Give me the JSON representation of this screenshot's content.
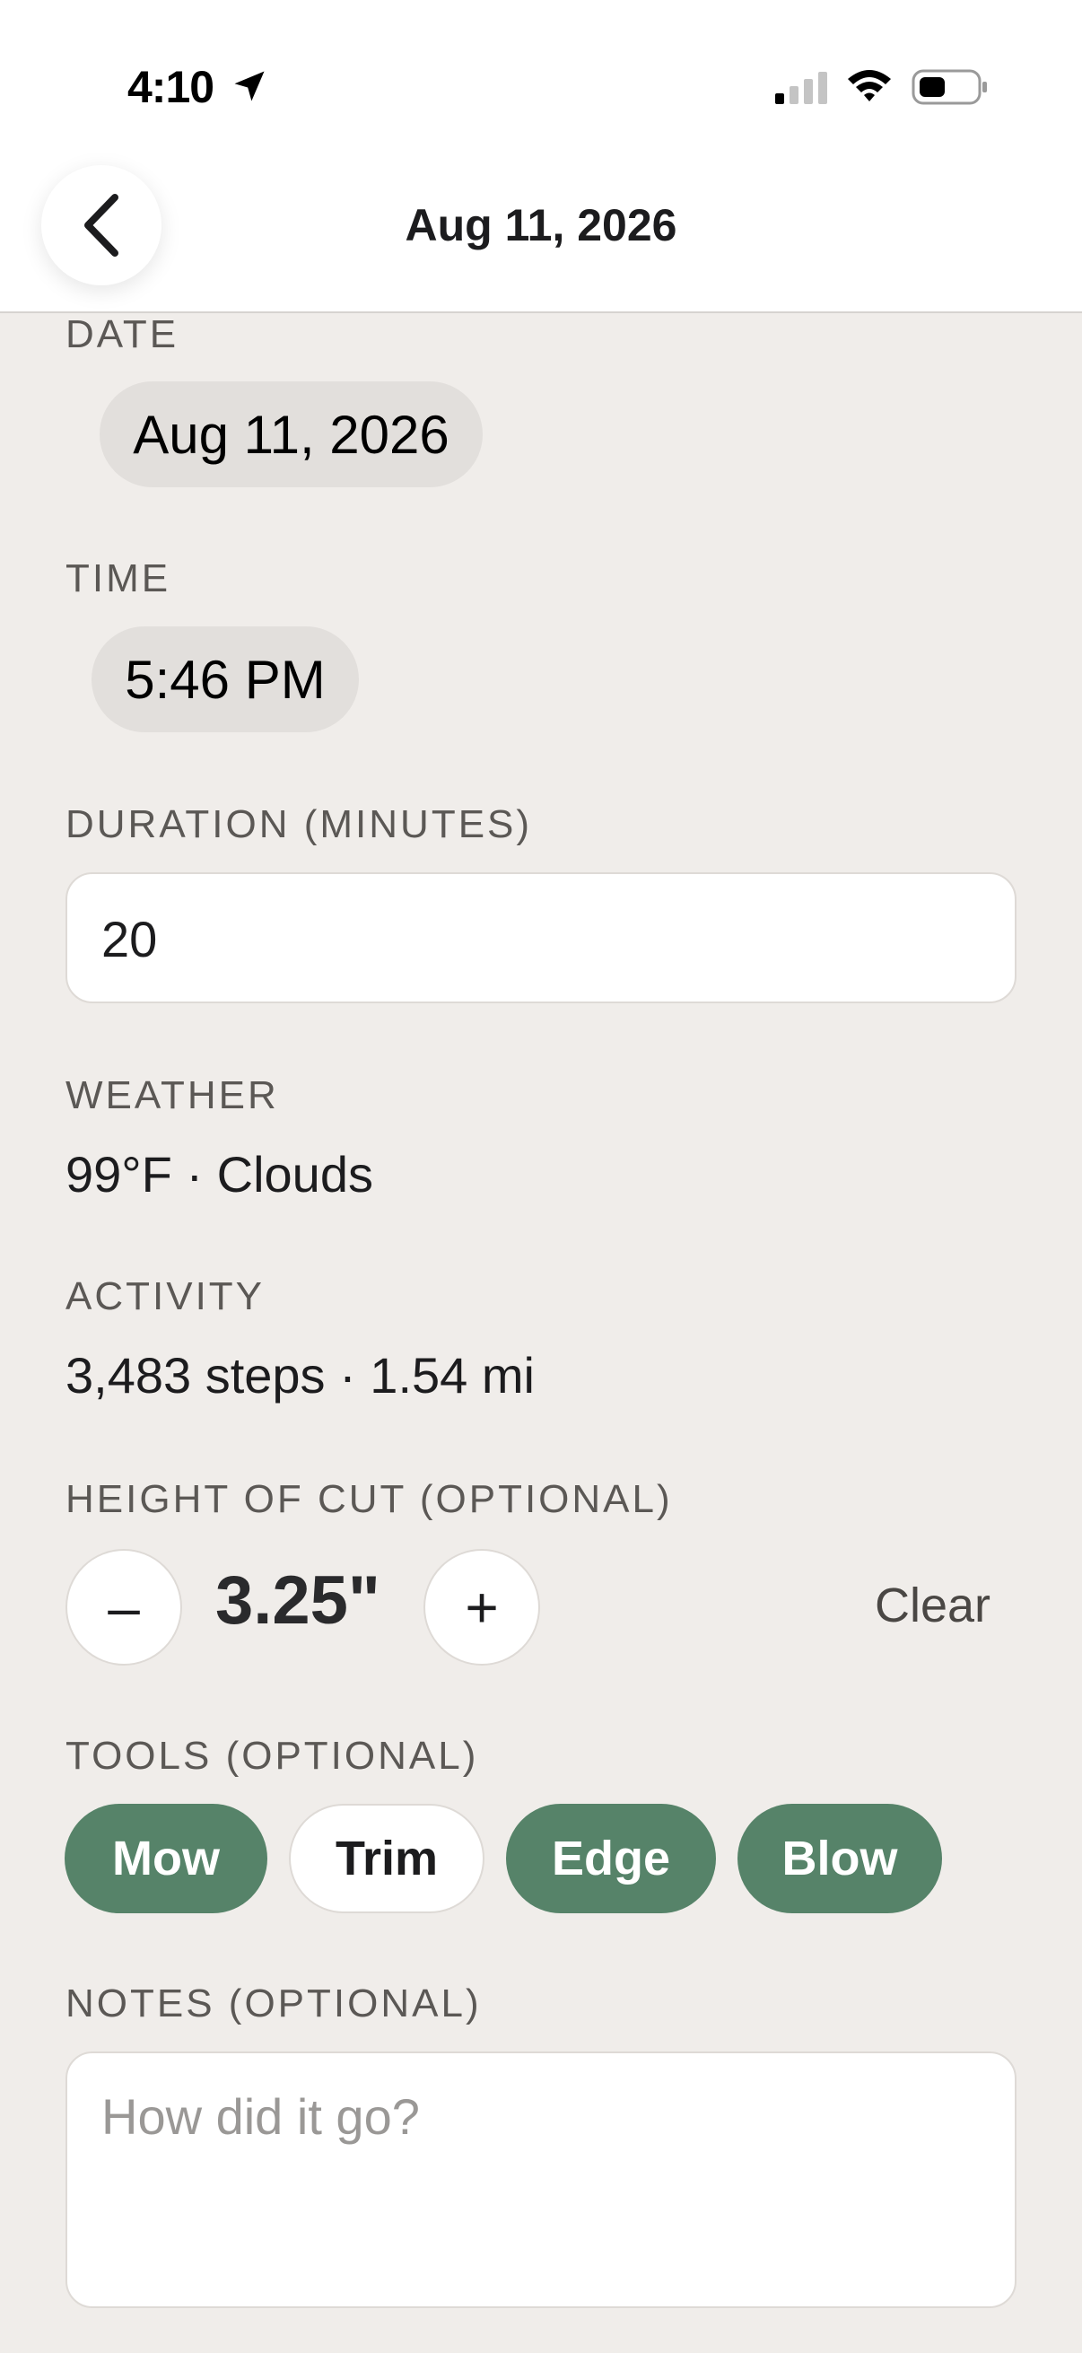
{
  "status_bar": {
    "time": "4:10"
  },
  "nav": {
    "title": "Aug 11, 2026"
  },
  "form": {
    "date": {
      "label": "DATE",
      "value": "Aug 11, 2026"
    },
    "time": {
      "label": "TIME",
      "value": "5:46 PM"
    },
    "duration": {
      "label": "DURATION (MINUTES)",
      "value": "20"
    },
    "weather": {
      "label": "WEATHER",
      "value": "99°F · Clouds"
    },
    "activity": {
      "label": "ACTIVITY",
      "value": "3,483 steps · 1.54 mi"
    },
    "height_of_cut": {
      "label": "HEIGHT OF CUT (OPTIONAL)",
      "value": "3.25\"",
      "decrement_label": "–",
      "increment_label": "+",
      "clear_label": "Clear"
    },
    "tools": {
      "label": "TOOLS (OPTIONAL)",
      "items": [
        {
          "label": "Mow",
          "selected": true
        },
        {
          "label": "Trim",
          "selected": false
        },
        {
          "label": "Edge",
          "selected": true
        },
        {
          "label": "Blow",
          "selected": true
        }
      ]
    },
    "notes": {
      "label": "NOTES (OPTIONAL)",
      "placeholder": "How did it go?"
    }
  },
  "colors": {
    "accent": "#568369",
    "background": "#f0edea",
    "pill": "#e2dfdc"
  }
}
